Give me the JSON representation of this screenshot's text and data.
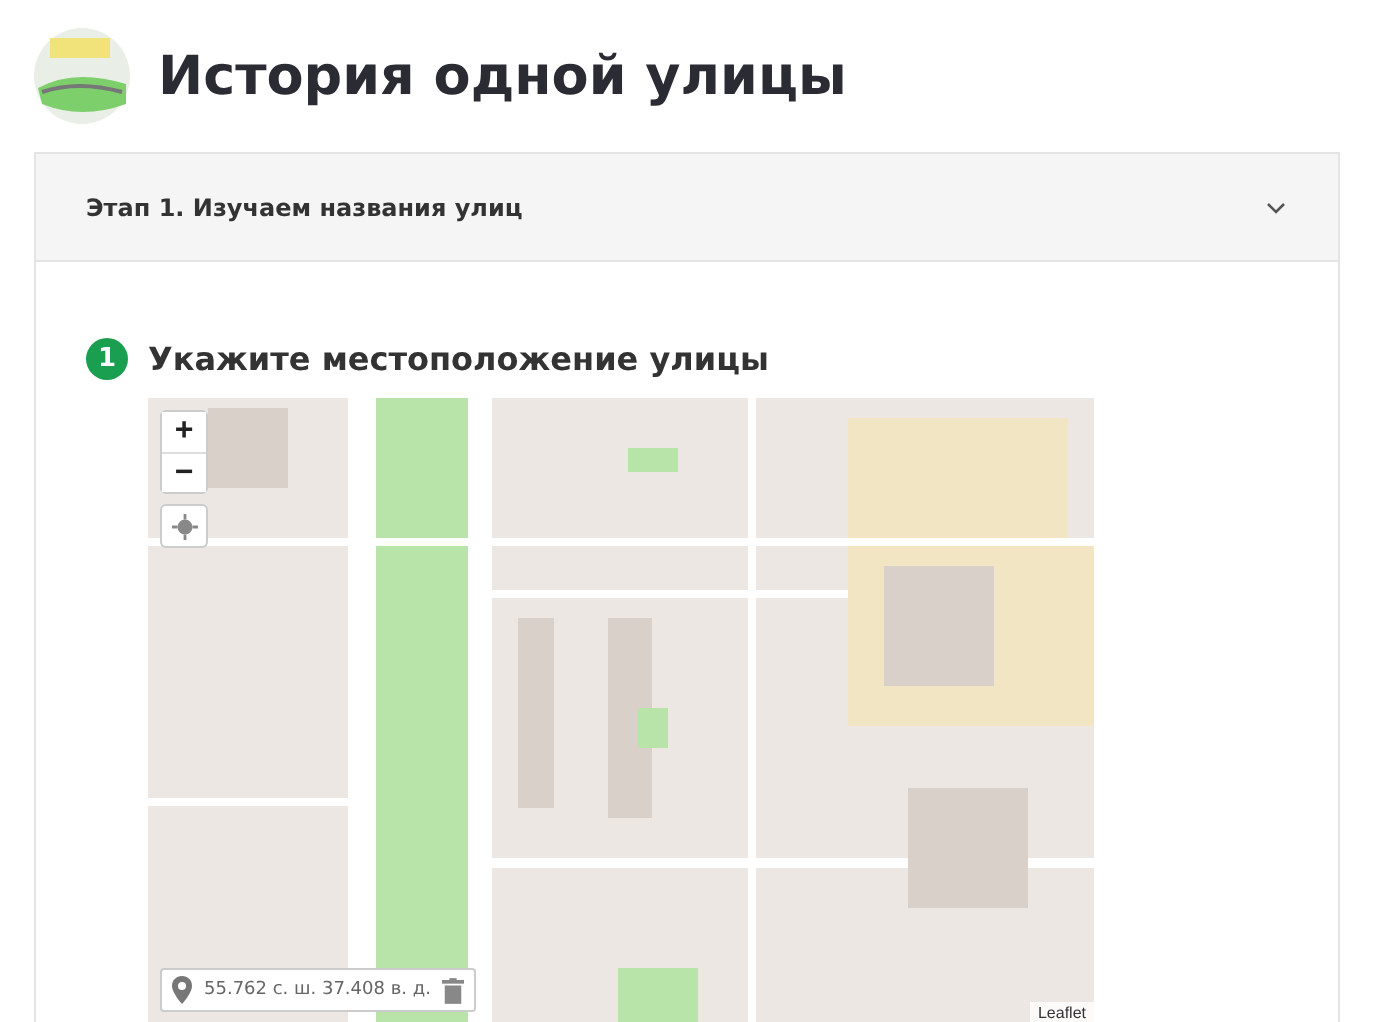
{
  "header": {
    "title": "История одной улицы"
  },
  "accordion": {
    "title": "Этап 1. Изучаем названия улиц",
    "expanded": true
  },
  "step": {
    "number": "1",
    "title": "Укажите местоположение улицы"
  },
  "map": {
    "zoom_in": "+",
    "zoom_out": "−",
    "coordinates": "55.762 с. ш. 37.408 в. д.",
    "attribution": "Leaflet"
  }
}
